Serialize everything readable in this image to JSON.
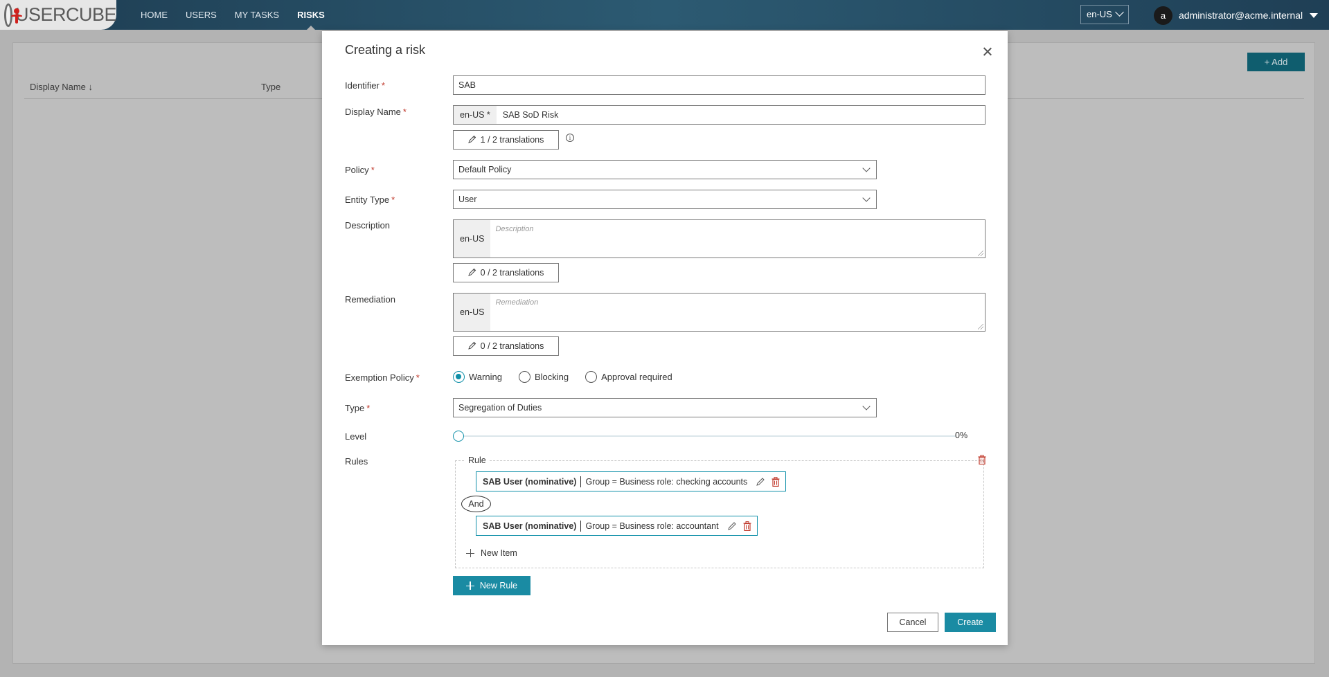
{
  "app": {
    "logo_text": "USERCUBE"
  },
  "nav": {
    "items": [
      {
        "label": "HOME"
      },
      {
        "label": "USERS"
      },
      {
        "label": "MY TASKS"
      },
      {
        "label": "RISKS"
      }
    ]
  },
  "header": {
    "language": "en-US",
    "user_initial": "a",
    "user_email": "administrator@acme.internal"
  },
  "background": {
    "add_label": "Add",
    "columns": [
      "Display Name ↓",
      "Type"
    ]
  },
  "modal": {
    "title": "Creating a risk",
    "required_mark": "*",
    "identifier": {
      "label": "Identifier",
      "value": "SAB"
    },
    "display_name": {
      "label": "Display Name",
      "locale": "en-US *",
      "value": "SAB SoD Risk",
      "translations": "1 / 2 translations"
    },
    "policy": {
      "label": "Policy",
      "value": "Default Policy"
    },
    "entity_type": {
      "label": "Entity Type",
      "value": "User"
    },
    "description": {
      "label": "Description",
      "locale": "en-US",
      "placeholder": "Description",
      "translations": "0 / 2 translations"
    },
    "remediation": {
      "label": "Remediation",
      "locale": "en-US",
      "placeholder": "Remediation",
      "translations": "0 / 2 translations"
    },
    "exemption_policy": {
      "label": "Exemption Policy",
      "options": [
        {
          "label": "Warning",
          "checked": true
        },
        {
          "label": "Blocking",
          "checked": false
        },
        {
          "label": "Approval required",
          "checked": false
        }
      ]
    },
    "type": {
      "label": "Type",
      "value": "Segregation of Duties"
    },
    "level": {
      "label": "Level",
      "value": "0%",
      "fraction": 0
    },
    "rules": {
      "label": "Rules",
      "rule_legend": "Rule",
      "items": [
        {
          "name": "SAB User (nominative)",
          "condition": "Group = Business role: checking accounts"
        },
        {
          "name": "SAB User (nominative)",
          "condition": "Group = Business role: accountant"
        }
      ],
      "operator": "And",
      "new_item": "New Item",
      "new_rule": "New Rule"
    },
    "cancel_label": "Cancel",
    "create_label": "Create"
  },
  "colors": {
    "accent": "#1a8ba3",
    "delete": "#c0392b",
    "topbar": "#2c5a72"
  }
}
